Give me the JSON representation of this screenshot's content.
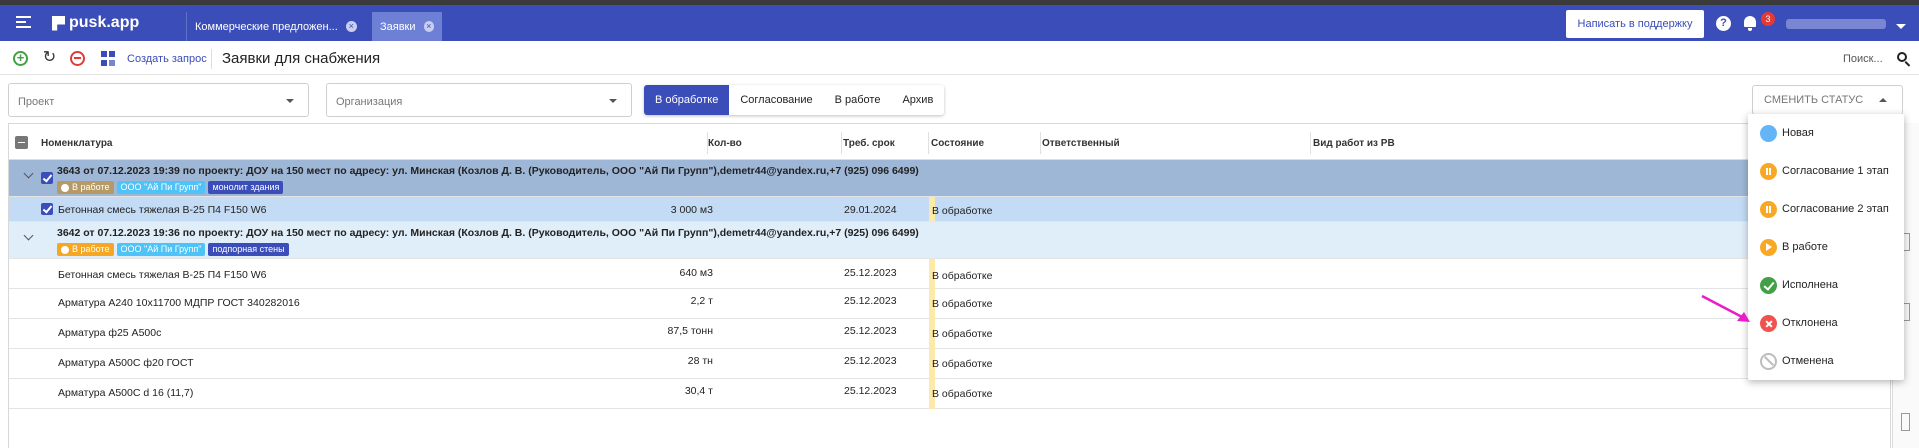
{
  "appbar": {
    "logo": "pusk.app",
    "tabs": [
      {
        "label": "Коммерческие предложен..."
      },
      {
        "label": "Заявки"
      }
    ],
    "support_label": "Написать в поддержку",
    "help_glyph": "?",
    "notification_count": "3"
  },
  "toolbar": {
    "create_label": "Создать запрос",
    "title": "Заявки для снабжения",
    "search_label": "Поиск..."
  },
  "filters": {
    "project_placeholder": "Проект",
    "org_placeholder": "Организация",
    "segments": [
      "В обработке",
      "Согласование",
      "В работе",
      "Архив"
    ],
    "active_segment": "В обработке",
    "status_button": "СМЕНИТЬ СТАТУС"
  },
  "grid": {
    "columns": [
      "Номенклатура",
      "Кол-во",
      "Треб. срок",
      "Состояние",
      "Ответственный",
      "Вид работ из РВ"
    ],
    "groups": [
      {
        "title": "3643 от 07.12.2023 19:39 по проекту: ДОУ на 150 мест по адресу: ул. Минская (Козлов Д. В. (Руководитель, ООО \"Ай Пи Групп\"),demetr44@yandex.ru,+7 (925) 096 6499)",
        "tags": [
          "В работе",
          "ООО \"Ай Пи Групп\"",
          "монолит здания"
        ],
        "items": [
          {
            "name": "Бетонная смесь тяжелая В-25 П4 F150 W6",
            "qty": "3 000 м3",
            "date": "29.01.2024",
            "state": "В обработке"
          }
        ]
      },
      {
        "title": "3642 от 07.12.2023 19:36 по проекту: ДОУ на 150 мест по адресу: ул. Минская (Козлов Д. В. (Руководитель, ООО \"Ай Пи Групп\"),demetr44@yandex.ru,+7 (925) 096 6499)",
        "tags": [
          "В работе",
          "ООО \"Ай Пи Групп\"",
          "подпорная стены"
        ],
        "items": [
          {
            "name": "Бетонная смесь тяжелая В-25 П4 F150 W6",
            "qty": "640 м3",
            "date": "25.12.2023",
            "state": "В обработке"
          },
          {
            "name": "Арматура А240 10х11700 МДПР ГОСТ 340282016",
            "qty": "2,2 т",
            "date": "25.12.2023",
            "state": "В обработке"
          },
          {
            "name": "Арматура ф25 А500с",
            "qty": "87,5 тонн",
            "date": "25.12.2023",
            "state": "В обработке"
          },
          {
            "name": "Арматура А500С ф20 ГОСТ",
            "qty": "28 тн",
            "date": "25.12.2023",
            "state": "В обработке"
          },
          {
            "name": "Арматура А500С d 16 (11,7)",
            "qty": "30,4 т",
            "date": "25.12.2023",
            "state": "В обработке"
          }
        ]
      }
    ]
  },
  "status_menu": {
    "items": [
      {
        "label": "Новая",
        "icon": "new-status-icon"
      },
      {
        "label": "Согласование 1 этап",
        "icon": "pause-icon"
      },
      {
        "label": "Согласование 2 этап",
        "icon": "pause-icon"
      },
      {
        "label": "В работе",
        "icon": "play-icon"
      },
      {
        "label": "Исполнена",
        "icon": "check-icon"
      },
      {
        "label": "Отклонена",
        "icon": "reject-icon"
      },
      {
        "label": "Отменена",
        "icon": "cancel-icon"
      }
    ]
  },
  "colors": {
    "brand": "#3b4db8",
    "annotation_arrow": "#e91ec8"
  }
}
